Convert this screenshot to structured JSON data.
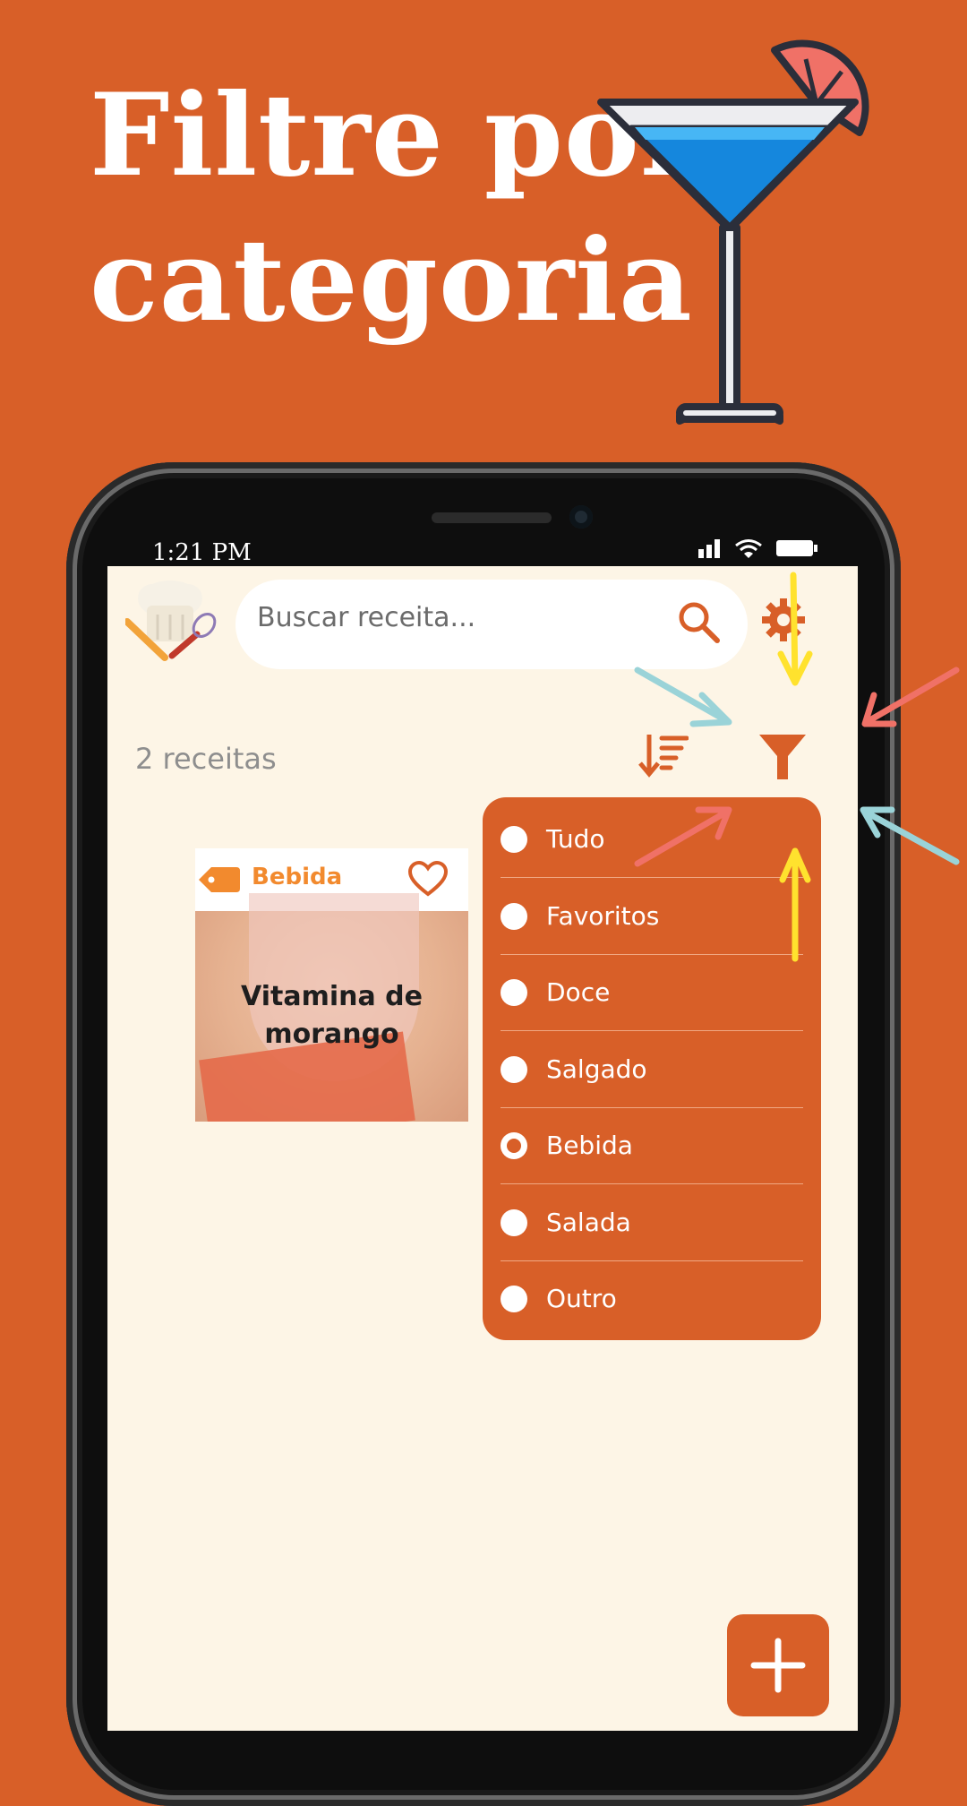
{
  "headline": {
    "line1": "Filtre por",
    "line2": "categoria"
  },
  "status_bar": {
    "time": "1:21 PM",
    "icons": [
      "signal-icon",
      "wifi-icon",
      "battery-icon"
    ]
  },
  "app": {
    "search": {
      "placeholder": "Buscar receita..."
    },
    "recipe_count": "2 receitas",
    "card": {
      "category": "Bebida",
      "title": "Vitamina de morango"
    },
    "filter_menu": {
      "items": [
        {
          "label": "Tudo",
          "selected": false
        },
        {
          "label": "Favoritos",
          "selected": false
        },
        {
          "label": "Doce",
          "selected": false
        },
        {
          "label": "Salgado",
          "selected": false
        },
        {
          "label": "Bebida",
          "selected": true
        },
        {
          "label": "Salada",
          "selected": false
        },
        {
          "label": "Outro",
          "selected": false
        }
      ]
    }
  },
  "colors": {
    "brand_orange": "#D85F28",
    "screen_bg": "#FDF5E6",
    "accent_tag": "#F28A2E",
    "arrow_cyan": "#9AD3D8",
    "arrow_red": "#F07167",
    "arrow_yellow": "#FFE22E"
  }
}
